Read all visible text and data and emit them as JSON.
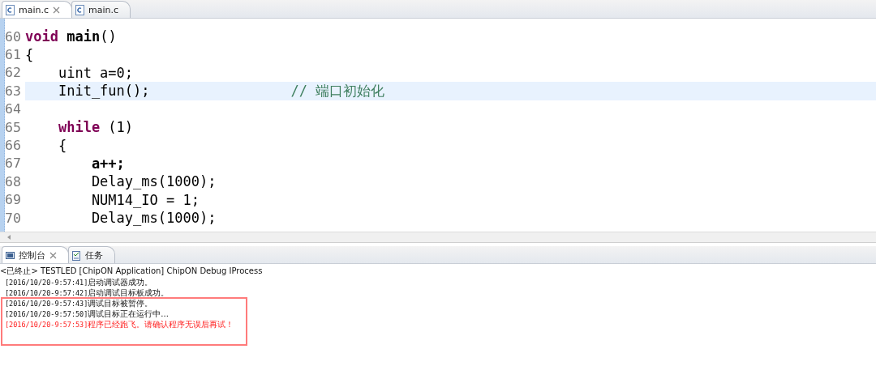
{
  "editor_tabs": [
    {
      "label": "main.c",
      "selected": true,
      "closable": true
    },
    {
      "label": "main.c",
      "selected": false,
      "closable": false
    }
  ],
  "code_lines": [
    {
      "number": "60",
      "highlighted": false,
      "segments": [
        {
          "text": "void",
          "kind": "keyword"
        },
        {
          "text": " main",
          "kind": "bold"
        },
        {
          "text": "()",
          "kind": "plain"
        }
      ]
    },
    {
      "number": "61",
      "highlighted": false,
      "segments": [
        {
          "text": "{",
          "kind": "plain"
        }
      ]
    },
    {
      "number": "62",
      "highlighted": false,
      "segments": [
        {
          "text": "    uint a=0;",
          "kind": "plain"
        }
      ]
    },
    {
      "number": "63",
      "highlighted": true,
      "segments": [
        {
          "text": "    Init_fun();                 ",
          "kind": "plain"
        },
        {
          "text": "// 端口初始化",
          "kind": "comment"
        }
      ]
    },
    {
      "number": "64",
      "highlighted": false
    },
    {
      "number": "65",
      "highlighted": false,
      "segments": [
        {
          "text": "    while",
          "kind": "keyword"
        },
        {
          "text": " (1)",
          "kind": "plain"
        }
      ]
    },
    {
      "number": "66",
      "highlighted": false,
      "segments": [
        {
          "text": "    {",
          "kind": "plain"
        }
      ]
    },
    {
      "number": "67",
      "highlighted": false,
      "segments": [
        {
          "text": "        a++;",
          "kind": "bold"
        }
      ]
    },
    {
      "number": "68",
      "highlighted": false,
      "segments": [
        {
          "text": "        Delay_ms(1000);",
          "kind": "plain"
        }
      ]
    },
    {
      "number": "69",
      "highlighted": false,
      "segments": [
        {
          "text": "        NUM14_IO = 1;",
          "kind": "plain"
        }
      ]
    },
    {
      "number": "70",
      "highlighted": false,
      "segments": [
        {
          "text": "        Delay_ms(1000);",
          "kind": "plain"
        }
      ]
    }
  ],
  "console_tabs": [
    {
      "label": "控制台",
      "selected": true,
      "closable": true
    },
    {
      "label": "任务",
      "selected": false,
      "closable": false
    }
  ],
  "console_header": "<已终止> TESTLED [ChipON Application] ChipON Debug IProcess",
  "console_lines": [
    {
      "timestamp": "[2016/10/20-9:57:41]",
      "message": "启动调试器成功。",
      "kind": "info"
    },
    {
      "timestamp": "[2016/10/20-9:57:42]",
      "message": "启动调试目标板成功。",
      "kind": "info"
    },
    {
      "timestamp": "[2016/10/20-9:57:43]",
      "message": "调试目标被暂停。",
      "kind": "info"
    },
    {
      "timestamp": "[2016/10/20-9:57:50]",
      "message": "调试目标正在运行中...",
      "kind": "info"
    },
    {
      "timestamp": "[2016/10/20-9:57:53]",
      "message": "程序已经跑飞。请确认程序无误后再试！",
      "kind": "error"
    }
  ]
}
